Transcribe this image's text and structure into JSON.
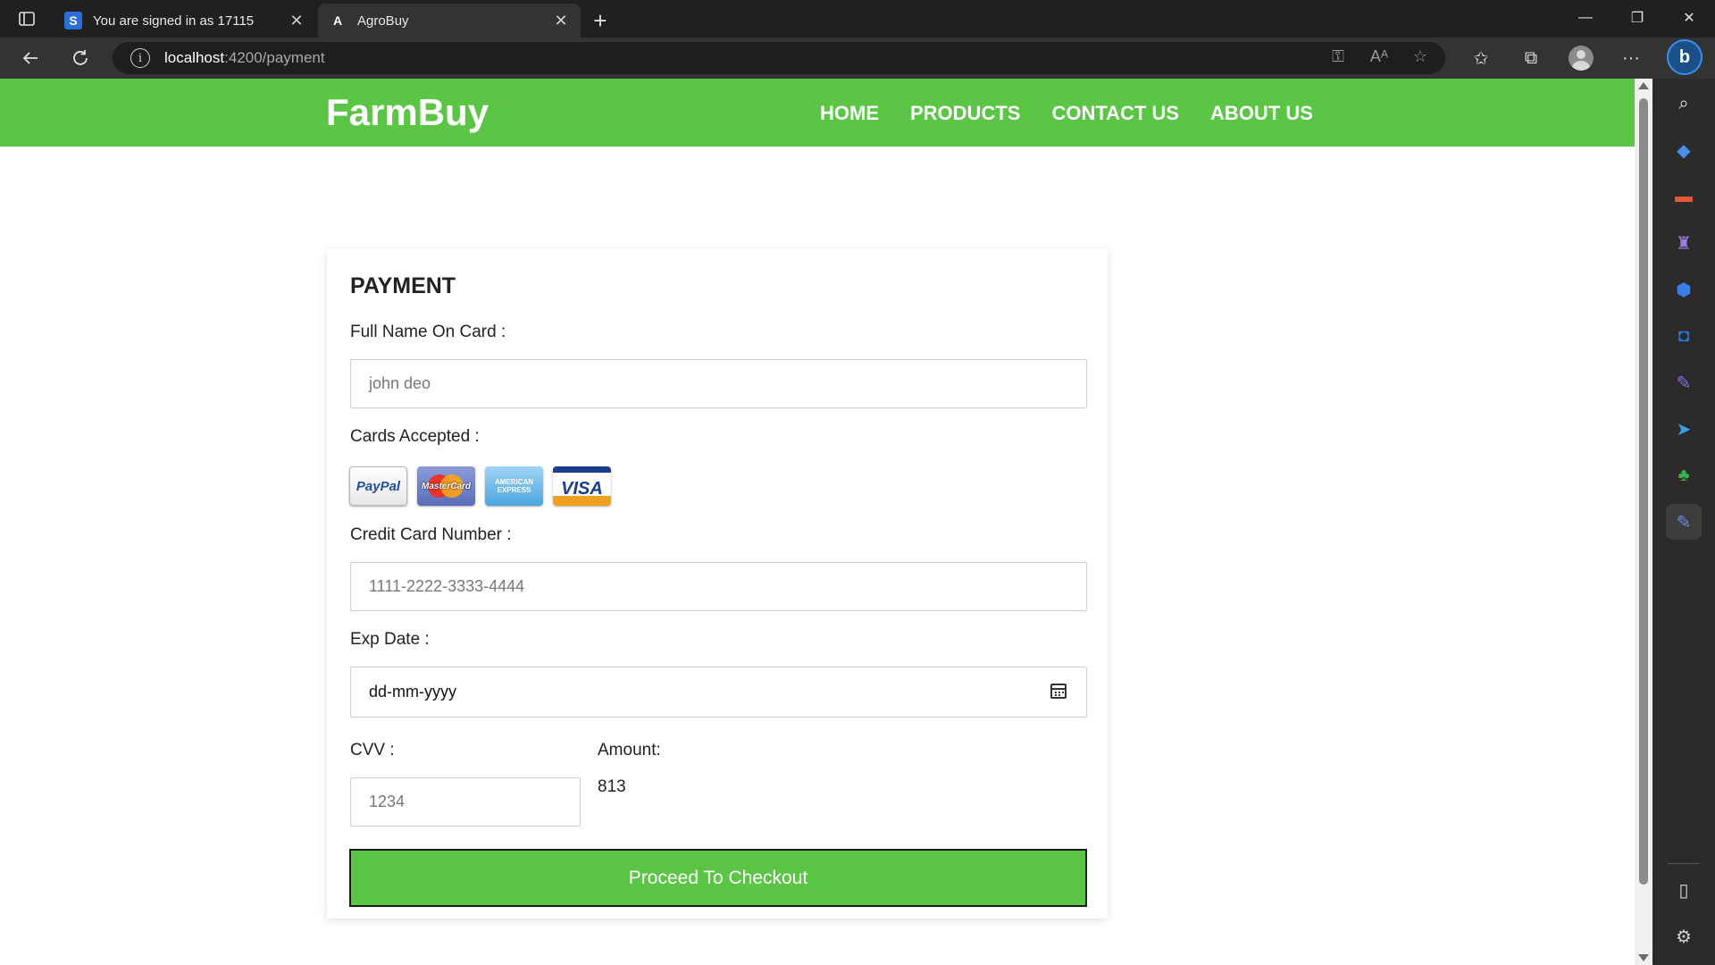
{
  "browser": {
    "tabs": [
      {
        "title": "You are signed in as 17115",
        "favicon_letter": "S",
        "favicon_color": "#2a6fd6"
      },
      {
        "title": "AgroBuy",
        "favicon_letter": "A",
        "favicon_color": "#ffffff"
      }
    ],
    "url_host": "localhost",
    "url_path": ":4200/payment"
  },
  "site": {
    "brand": "FarmBuy",
    "menu": [
      "HOME",
      "PRODUCTS",
      "CONTACT US",
      "ABOUT US"
    ],
    "brand_color": "#5bc546"
  },
  "payment": {
    "heading": "PAYMENT",
    "name_label": "Full Name On Card :",
    "name_placeholder": "john deo",
    "cards_label": "Cards Accepted :",
    "cards": [
      {
        "name": "paypal-card",
        "text": "PayPal"
      },
      {
        "name": "mastercard-card",
        "text": "MasterCard"
      },
      {
        "name": "amex-card",
        "text": "AMERICAN EXPRESS"
      },
      {
        "name": "visa-card",
        "text": "VISA"
      }
    ],
    "cc_label": "Credit Card Number :",
    "cc_placeholder": "1111-2222-3333-4444",
    "exp_label": "Exp Date :",
    "exp_value": "dd-mm-yyyy",
    "cvv_label": "CVV :",
    "cvv_placeholder": "1234",
    "amount_label": "Amount:",
    "amount_value": "813",
    "checkout_label": "Proceed To Checkout"
  }
}
